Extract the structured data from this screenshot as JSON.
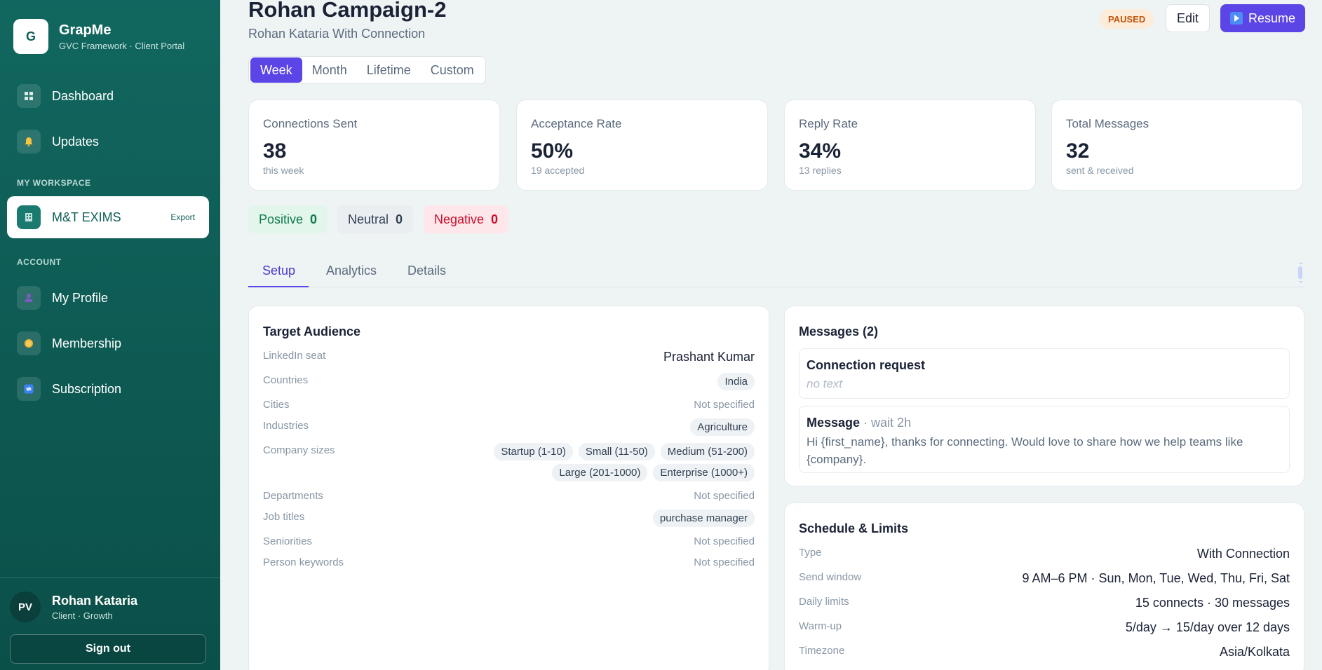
{
  "sidebar": {
    "brand": {
      "logo_letter": "G",
      "name": "GrapMe",
      "subtitle": "GVC Framework · Client Portal"
    },
    "nav": [
      {
        "label": "Dashboard",
        "icon": "grid-icon"
      },
      {
        "label": "Updates",
        "icon": "bell-icon"
      }
    ],
    "workspace_section": "MY WORKSPACE",
    "workspace_item": {
      "label": "M&T EXIMS",
      "icon": "building-icon",
      "action": "Export"
    },
    "account_section": "ACCOUNT",
    "account_nav": [
      {
        "label": "My Profile",
        "icon": "person-icon"
      },
      {
        "label": "Membership",
        "icon": "coin-icon"
      },
      {
        "label": "Subscription",
        "icon": "refresh-icon"
      }
    ],
    "user": {
      "initials": "PV",
      "name": "Rohan Kataria",
      "role": "Client · Growth"
    },
    "sign_out": "Sign out"
  },
  "header": {
    "title": "Rohan Campaign-2",
    "subtitle": "Rohan Kataria With Connection",
    "status": "PAUSED",
    "edit_label": "Edit",
    "resume_label": "Resume"
  },
  "range_tabs": {
    "items": [
      "Week",
      "Month",
      "Lifetime",
      "Custom"
    ],
    "selected": "Week"
  },
  "stats": [
    {
      "label": "Connections Sent",
      "value": "38",
      "sub": "this week"
    },
    {
      "label": "Acceptance Rate",
      "value": "50%",
      "sub": "19 accepted"
    },
    {
      "label": "Reply Rate",
      "value": "34%",
      "sub": "13 replies"
    },
    {
      "label": "Total Messages",
      "value": "32",
      "sub": "sent & received"
    }
  ],
  "sentiment": [
    {
      "label": "Positive",
      "count": "0"
    },
    {
      "label": "Neutral",
      "count": "0"
    },
    {
      "label": "Negative",
      "count": "0"
    }
  ],
  "content_tabs": {
    "items": [
      "Setup",
      "Analytics",
      "Details"
    ],
    "selected": "Setup"
  },
  "target_audience": {
    "title": "Target Audience",
    "linkedin_seat": {
      "label": "LinkedIn seat",
      "value": "Prashant Kumar"
    },
    "countries": {
      "label": "Countries",
      "chips": [
        "India"
      ]
    },
    "cities": {
      "label": "Cities",
      "value": "Not specified"
    },
    "industries": {
      "label": "Industries",
      "chips": [
        "Agriculture"
      ]
    },
    "company_sizes": {
      "label": "Company sizes",
      "chips": [
        "Startup (1-10)",
        "Small (11-50)",
        "Medium (51-200)",
        "Large (201-1000)",
        "Enterprise (1000+)"
      ]
    },
    "departments": {
      "label": "Departments",
      "value": "Not specified"
    },
    "job_titles": {
      "label": "Job titles",
      "chips": [
        "purchase manager"
      ]
    },
    "seniorities": {
      "label": "Seniorities",
      "value": "Not specified"
    },
    "person_keywords": {
      "label": "Person keywords",
      "value": "Not specified"
    }
  },
  "messages": {
    "title": "Messages (2)",
    "items": [
      {
        "title": "Connection request",
        "wait": "",
        "body": "no text"
      },
      {
        "title": "Message",
        "wait": " · wait 2h",
        "body": "Hi {first_name}, thanks for connecting. Would love to share how we help teams like {company}."
      }
    ]
  },
  "schedule": {
    "title": "Schedule & Limits",
    "rows": [
      {
        "label": "Type",
        "value": "With Connection"
      },
      {
        "label": "Send window",
        "value": "9 AM–6 PM · Sun, Mon, Tue, Wed, Thu, Fri, Sat"
      },
      {
        "label": "Daily limits",
        "value": "15 connects · 30 messages"
      },
      {
        "label": "Warm-up",
        "value": "5/day → 15/day over 12 days"
      },
      {
        "label": "Timezone",
        "value": "Asia/Kolkata"
      }
    ]
  }
}
